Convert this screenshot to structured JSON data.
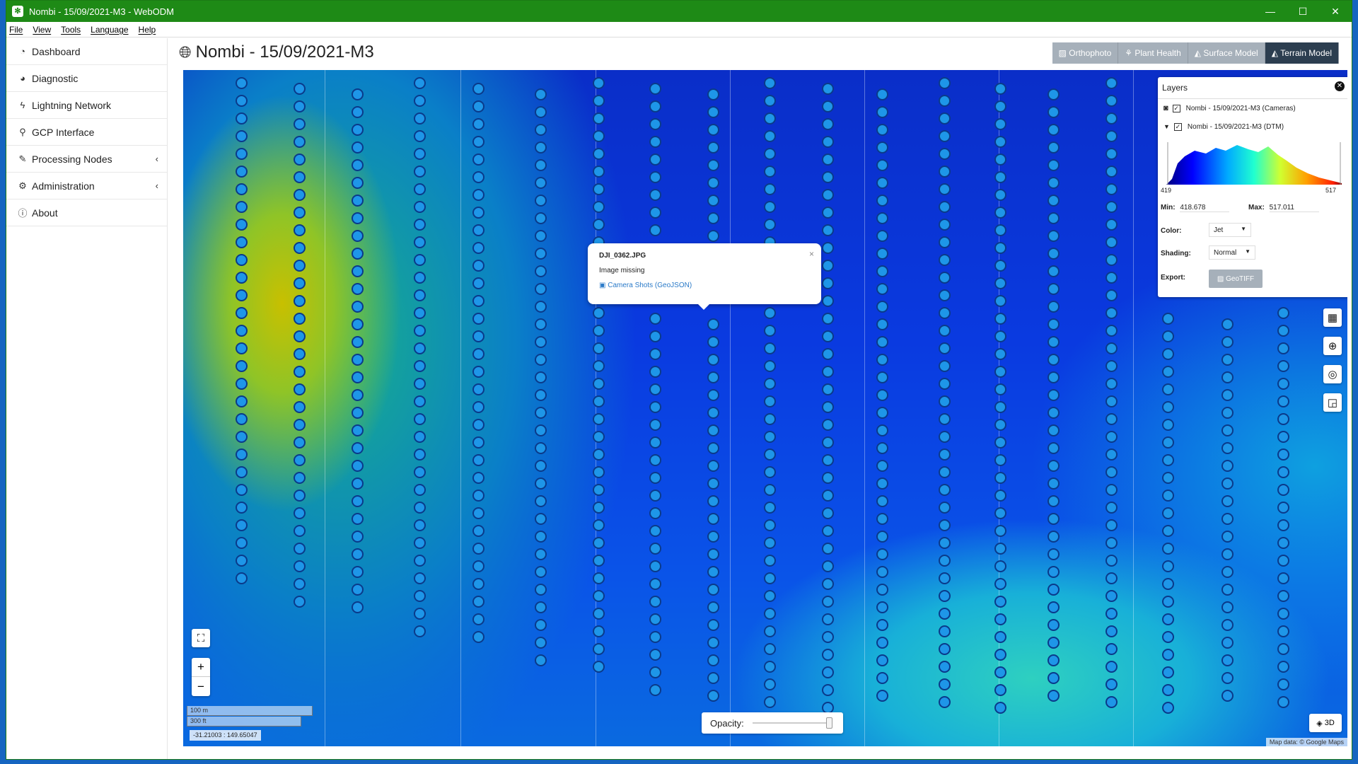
{
  "window": {
    "title": "Nombi - 15/09/2021-M3 - WebODM",
    "app_icon": "webodm-icon",
    "controls": {
      "minimize": "—",
      "maximize": "☐",
      "close": "✕"
    }
  },
  "menu": [
    "File",
    "View",
    "Tools",
    "Language",
    "Help"
  ],
  "sidebar": {
    "items": [
      {
        "label": "Dashboard",
        "icon": "dashboard-icon",
        "glyph": "◔"
      },
      {
        "label": "Diagnostic",
        "icon": "pie-chart-icon",
        "glyph": "◕"
      },
      {
        "label": "Lightning Network",
        "icon": "bolt-icon",
        "glyph": "ϟ"
      },
      {
        "label": "GCP Interface",
        "icon": "map-marker-icon",
        "glyph": "⚲"
      },
      {
        "label": "Processing Nodes",
        "icon": "wrench-icon",
        "glyph": "✎",
        "chevron": "‹"
      },
      {
        "label": "Administration",
        "icon": "cogs-icon",
        "glyph": "⚙",
        "chevron": "‹"
      },
      {
        "label": "About",
        "icon": "info-icon",
        "glyph": "ⓘ"
      }
    ]
  },
  "page": {
    "title": "Nombi - 15/09/2021-M3",
    "icon": "globe-icon"
  },
  "toolbar": {
    "buttons": [
      {
        "label": "Orthophoto",
        "glyph": "▨",
        "active": false
      },
      {
        "label": "Plant Health",
        "glyph": "⚘",
        "active": false
      },
      {
        "label": "Surface Model",
        "glyph": "◭",
        "active": false
      },
      {
        "label": "Terrain Model",
        "glyph": "◭",
        "active": true
      }
    ]
  },
  "popup": {
    "title": "DJI_0362.JPG",
    "status": "Image missing",
    "link": "Camera Shots (GeoJSON)",
    "close": "×"
  },
  "layers": {
    "header": "Layers",
    "rows": [
      {
        "label": "Nombi - 15/09/2021-M3 (Cameras)",
        "checked": true,
        "icon": "camera-icon"
      },
      {
        "label": "Nombi - 15/09/2021-M3 (DTM)",
        "checked": true,
        "icon": "caret-down-icon"
      }
    ],
    "histogram": {
      "min_label": "419",
      "max_label": "517"
    },
    "min_label": "Min:",
    "min_value": "418.678",
    "max_label": "Max:",
    "max_value": "517.011",
    "color_label": "Color:",
    "color_value": "Jet",
    "shading_label": "Shading:",
    "shading_value": "Normal",
    "export_label": "Export:",
    "export_button": "GeoTIFF"
  },
  "map": {
    "scale_metric": "100 m",
    "scale_imperial": "300 ft",
    "coords": "-31.21003 : 149.65047",
    "opacity_label": "Opacity:",
    "opacity_value": 1.0,
    "btn3d": "3D",
    "attribution": "Map data: © Google Maps"
  },
  "colors": {
    "titlebar": "#1e8a16",
    "active_tool": "#2c3e50",
    "tool": "#a6b0ba",
    "dot": "#1e96e8",
    "dot_border": "#0a3a8a"
  }
}
